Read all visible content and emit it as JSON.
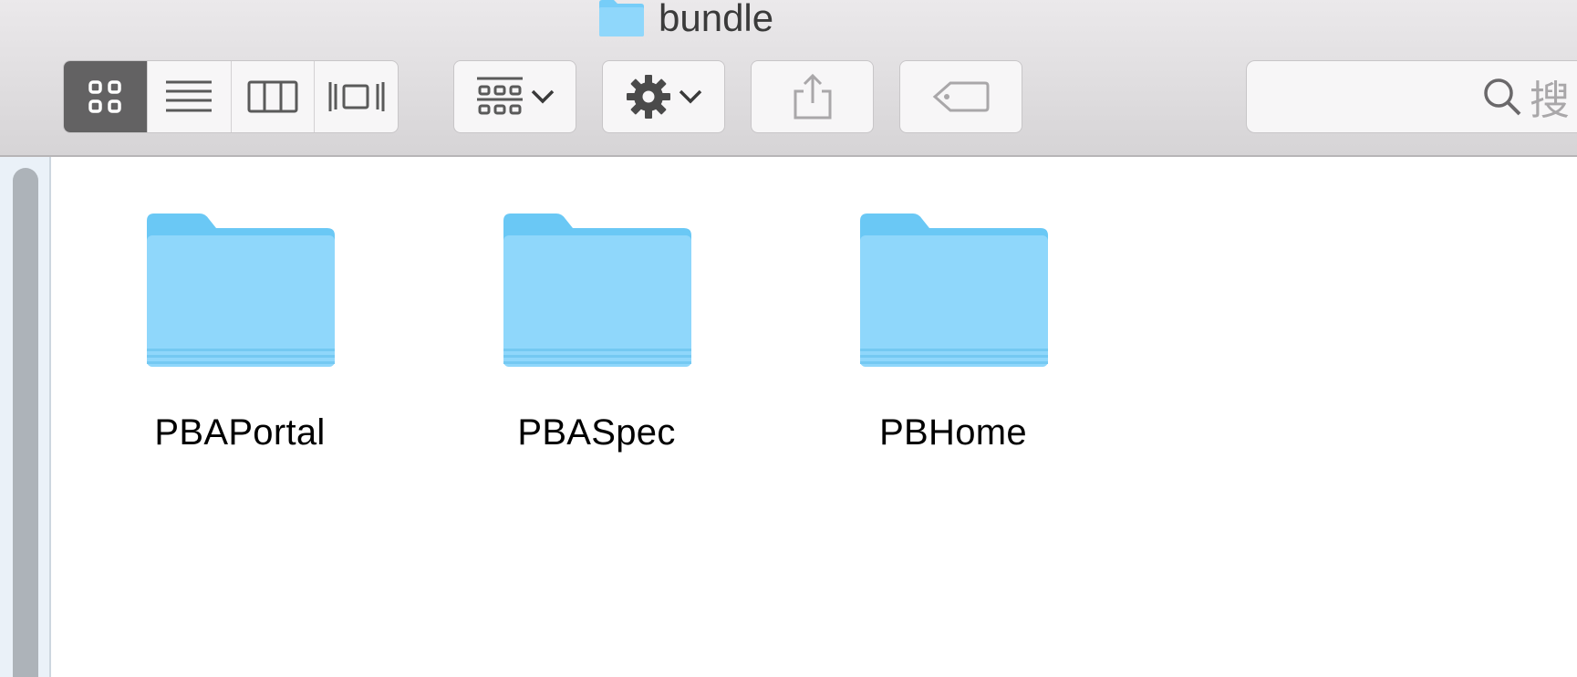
{
  "window": {
    "title": "bundle"
  },
  "toolbar": {
    "view_modes": [
      {
        "name": "icon-view",
        "active": true
      },
      {
        "name": "list-view",
        "active": false
      },
      {
        "name": "column-view",
        "active": false
      },
      {
        "name": "cover-flow-view",
        "active": false
      }
    ],
    "icons": [
      "grid-icon",
      "list-icon",
      "columns-icon",
      "cover-flow-icon",
      "group-icon",
      "gear-icon",
      "chevron-down-icon",
      "share-icon",
      "tag-icon",
      "search-icon"
    ],
    "search_placeholder": "搜"
  },
  "files": [
    {
      "name": "PBAPortal",
      "type": "folder"
    },
    {
      "name": "PBASpec",
      "type": "folder"
    },
    {
      "name": "PBHome",
      "type": "folder"
    }
  ],
  "colors": {
    "folder_light": "#8fd7fb",
    "folder_dark": "#6ac8f5",
    "active_segment": "#636263"
  }
}
